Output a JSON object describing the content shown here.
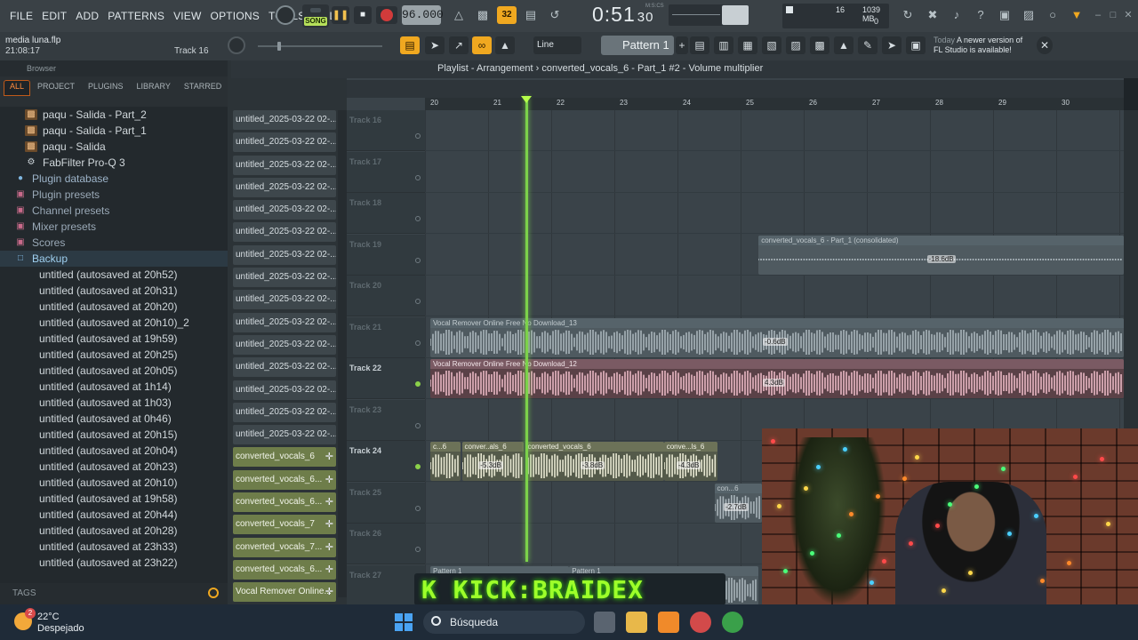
{
  "menu": [
    "FILE",
    "EDIT",
    "ADD",
    "PATTERNS",
    "VIEW",
    "OPTIONS",
    "TOOLS",
    "HELP"
  ],
  "transport": {
    "mode_label": "SONG",
    "tempo": "96.000",
    "time": "0:51",
    "time_sub": "30",
    "time_unit": "M:S:CS"
  },
  "meters": {
    "voices": "16",
    "memory": "1039 MB",
    "cpu_zero": "0"
  },
  "project": {
    "file": "media luna.flp",
    "elapsed": "21:08:17",
    "track": "Track 16"
  },
  "toolbar2": {
    "snap": "Line",
    "pattern": "Pattern 1"
  },
  "news": {
    "today": "Today",
    "message1": "A newer version of",
    "message2": "FL Studio is available!"
  },
  "browser": {
    "title": "Browser",
    "tabs": [
      "ALL",
      "PROJECT",
      "PLUGINS",
      "LIBRARY",
      "STARRED"
    ],
    "active_tab": "ALL",
    "items": [
      {
        "label": "paqu - Salida - Part_2",
        "type": "file"
      },
      {
        "label": "paqu - Salida - Part_1",
        "type": "file"
      },
      {
        "label": "paqu - Salida",
        "type": "file"
      },
      {
        "label": "FabFilter Pro-Q 3",
        "type": "plugin"
      },
      {
        "label": "Plugin database",
        "type": "folder"
      },
      {
        "label": "Plugin presets",
        "type": "folder-pink"
      },
      {
        "label": "Channel presets",
        "type": "folder-pink"
      },
      {
        "label": "Mixer presets",
        "type": "folder-pink"
      },
      {
        "label": "Scores",
        "type": "folder-pink"
      },
      {
        "label": "Backup",
        "type": "folder-open"
      },
      {
        "label": "untitled (autosaved at 20h52)",
        "type": "backup"
      },
      {
        "label": "untitled (autosaved at 20h31)",
        "type": "backup"
      },
      {
        "label": "untitled (autosaved at 20h20)",
        "type": "backup"
      },
      {
        "label": "untitled (autosaved at 20h10)_2",
        "type": "backup"
      },
      {
        "label": "untitled (autosaved at 19h59)",
        "type": "backup"
      },
      {
        "label": "untitled (autosaved at 20h25)",
        "type": "backup"
      },
      {
        "label": "untitled (autosaved at 20h05)",
        "type": "backup"
      },
      {
        "label": "untitled (autosaved at 1h14)",
        "type": "backup"
      },
      {
        "label": "untitled (autosaved at 1h03)",
        "type": "backup"
      },
      {
        "label": "untitled (autosaved at 0h46)",
        "type": "backup"
      },
      {
        "label": "untitled (autosaved at 20h15)",
        "type": "backup"
      },
      {
        "label": "untitled (autosaved at 20h04)",
        "type": "backup"
      },
      {
        "label": "untitled (autosaved at 20h23)",
        "type": "backup"
      },
      {
        "label": "untitled (autosaved at 20h10)",
        "type": "backup"
      },
      {
        "label": "untitled (autosaved at 19h58)",
        "type": "backup"
      },
      {
        "label": "untitled (autosaved at 20h44)",
        "type": "backup"
      },
      {
        "label": "untitled (autosaved at 20h28)",
        "type": "backup"
      },
      {
        "label": "untitled (autosaved at 23h33)",
        "type": "backup"
      },
      {
        "label": "untitled (autosaved at 23h22)",
        "type": "backup"
      }
    ],
    "tags_label": "TAGS"
  },
  "picker": {
    "clips": [
      {
        "label": "untitled_2025-03-22 02-...",
        "kind": "audio"
      },
      {
        "label": "untitled_2025-03-22 02-...",
        "kind": "audio"
      },
      {
        "label": "untitled_2025-03-22 02-...",
        "kind": "audio"
      },
      {
        "label": "untitled_2025-03-22 02-...",
        "kind": "audio"
      },
      {
        "label": "untitled_2025-03-22 02-...",
        "kind": "audio"
      },
      {
        "label": "untitled_2025-03-22 02-...",
        "kind": "audio"
      },
      {
        "label": "untitled_2025-03-22 02-...",
        "kind": "audio"
      },
      {
        "label": "untitled_2025-03-22 02-...",
        "kind": "audio"
      },
      {
        "label": "untitled_2025-03-22 02-...",
        "kind": "audio"
      },
      {
        "label": "untitled_2025-03-22 02-...",
        "kind": "audio"
      },
      {
        "label": "untitled_2025-03-22 02-...",
        "kind": "audio"
      },
      {
        "label": "untitled_2025-03-22 02-...",
        "kind": "audio"
      },
      {
        "label": "untitled_2025-03-22 02-...",
        "kind": "audio"
      },
      {
        "label": "untitled_2025-03-22 02-...",
        "kind": "audio"
      },
      {
        "label": "untitled_2025-03-22 02-...",
        "kind": "audio"
      },
      {
        "label": "converted_vocals_6",
        "kind": "pattern"
      },
      {
        "label": "converted_vocals_6...",
        "kind": "pattern"
      },
      {
        "label": "converted_vocals_6...",
        "kind": "pattern"
      },
      {
        "label": "converted_vocals_7",
        "kind": "pattern"
      },
      {
        "label": "converted_vocals_7...",
        "kind": "pattern"
      },
      {
        "label": "converted_vocals_6...",
        "kind": "pattern"
      },
      {
        "label": "Vocal Remover Online...",
        "kind": "pattern"
      }
    ]
  },
  "playlist": {
    "title": "Playlist - Arrangement",
    "breadcrumb": "converted_vocals_6 - Part_1 #2 - Volume multiplier",
    "ruler": [
      "20",
      "21",
      "22",
      "23",
      "24",
      "25",
      "26",
      "27",
      "28",
      "29",
      "30"
    ],
    "tracks": [
      {
        "label": "Track 16",
        "active": false
      },
      {
        "label": "Track 17",
        "active": false
      },
      {
        "label": "Track 18",
        "active": false
      },
      {
        "label": "Track 19",
        "active": false
      },
      {
        "label": "Track 20",
        "active": false
      },
      {
        "label": "Track 21",
        "active": false
      },
      {
        "label": "Track 22",
        "active": true
      },
      {
        "label": "Track 23",
        "active": false
      },
      {
        "label": "Track 24",
        "active": true
      },
      {
        "label": "Track 25",
        "active": false
      },
      {
        "label": "Track 26",
        "active": false
      },
      {
        "label": "Track 27",
        "active": false
      }
    ],
    "clips": [
      {
        "track": 3,
        "start": 5.2,
        "len": 5.8,
        "style": "grey",
        "name": "converted_vocals_6 - Part_1 (consolidated)",
        "db": "-18.6dB",
        "flat": true
      },
      {
        "track": 5,
        "start": 0,
        "len": 11,
        "style": "grey",
        "name": "Vocal Remover Online Free  No Download_13",
        "db": "-0.6dB"
      },
      {
        "track": 6,
        "start": 0,
        "len": 11,
        "style": "pink",
        "name": "Vocal Remover Online Free  No Download_12",
        "db": "4.3dB"
      },
      {
        "track": 8,
        "start": 0,
        "len": 0.48,
        "style": "cream",
        "name": "c...6",
        "db": ""
      },
      {
        "track": 8,
        "start": 0.5,
        "len": 0.98,
        "style": "cream",
        "name": "conver..als_6",
        "db": "-5.3dB"
      },
      {
        "track": 8,
        "start": 1.5,
        "len": 2.2,
        "style": "cream",
        "name": "converted_vocals_6",
        "db": "-3.8dB"
      },
      {
        "track": 8,
        "start": 3.7,
        "len": 0.85,
        "style": "cream",
        "name": "conve...ls_6",
        "db": "-4.3dB"
      },
      {
        "track": 9,
        "start": 4.5,
        "len": 0.75,
        "style": "grey",
        "name": "con...6",
        "db": "-2.7dB"
      },
      {
        "track": 11,
        "start": 0,
        "len": 2.2,
        "style": "grey",
        "name": "Pattern 1",
        "db": ""
      },
      {
        "track": 11,
        "start": 2.2,
        "len": 3,
        "style": "grey",
        "name": "Pattern 1",
        "db": ""
      }
    ],
    "playhead_bar": 21.5
  },
  "banner": {
    "text": "K KICK:BRAIDEX"
  },
  "taskbar": {
    "temp": "22°C",
    "weather": "Despejado",
    "badge": "2",
    "search": "Búsqueda"
  },
  "colors": {
    "accent": "#f0a820",
    "playhead": "#7cd24a",
    "song": "#b6e05a",
    "banner_text": "#9dff2a"
  }
}
